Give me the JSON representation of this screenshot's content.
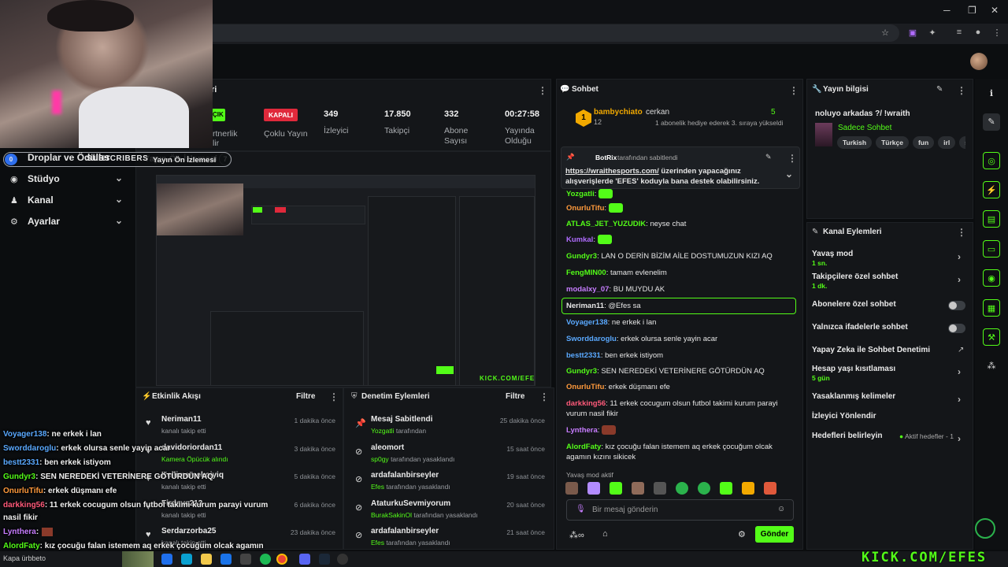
{
  "stats": {
    "status_badge": "ÇIK",
    "partner": "rtnerlik\nlir",
    "multistream_badge": "KAPALI",
    "multistream_label": "Çoklu Yayın",
    "viewers_value": "349",
    "viewers_label": "İzleyici",
    "followers_value": "17.850",
    "followers_label": "Takipçi",
    "subs_value": "332",
    "subs_label": "Abone Sayısı",
    "uptime_value": "00:27:58",
    "uptime_label": "Yayında Olduğu",
    "header_fragment": "ri"
  },
  "sidebar": {
    "drops_label": "Droplar ve Ödüller",
    "subscribers_overlay": "SUBSCRIBERS",
    "sub_count": "7",
    "sub_left": "0",
    "preview_label": "Yayın Ön İzlemesi",
    "items": [
      {
        "label": "Stüdyo"
      },
      {
        "label": "Kanal"
      },
      {
        "label": "Ayarlar"
      }
    ]
  },
  "activity": {
    "title": "Etkinlik Akışı",
    "filter": "Filtre",
    "rows": [
      {
        "name": "Neriman11",
        "desc": "kanalı takip etti",
        "time": "1 dakika önce"
      },
      {
        "name": "davidoriordan11",
        "desc": "Kamera Öpücük alındı",
        "time": "3 dakika önce"
      },
      {
        "name": "Kellimemekoiyiq",
        "desc": "kanalı takip etti",
        "time": "5 dakika önce"
      },
      {
        "name": "Firdevs213",
        "desc": "kanalı takip etti",
        "time": "6 dakika önce"
      },
      {
        "name": "Serdarzorba25",
        "desc": "kanalı takip etti",
        "time": "23 dakika önce"
      }
    ]
  },
  "moderation": {
    "title": "Denetim Eylemleri",
    "filter": "Filtre",
    "rows": [
      {
        "title": "Mesaj Sabitlendi",
        "by": "Yozgatli",
        "suffix": "tarafından",
        "time": "25 dakika önce"
      },
      {
        "title": "aleomort",
        "by": "sp0gy",
        "suffix": "tarafından yasaklandı",
        "time": "15 saat önce"
      },
      {
        "title": "ardafalanbirseyler",
        "by": "Efes",
        "suffix": "tarafından yasaklandı",
        "time": "19 saat önce"
      },
      {
        "title": "AtaturkuSevmiyorum",
        "by": "BurakSakinOl",
        "suffix": "tarafından yasaklandı",
        "time": "20 saat önce"
      },
      {
        "title": "ardafalanbirseyler",
        "by": "Efes",
        "suffix": "tarafından yasaklandı",
        "time": "21 saat önce"
      }
    ]
  },
  "chat": {
    "title": "Sohbet",
    "gifter": "bambychiato",
    "gifter_count": "12",
    "gift_to": "cerkan",
    "gift_badge": "5",
    "gift_text": "1 abonelik hediye ederek 3. sıraya yükseldi",
    "pinned_by": "BotRix",
    "pinned_suffix": "tarafından sabitlendi",
    "pinned_link": "https://wraithesports.com/",
    "pinned_text": " üzerinden yapacağınız alışverişlerde 'EFES' koduyla bana destek olabilirsiniz.",
    "slow_mode": "Yavaş mod aktif",
    "input_placeholder": "Bir mesaj gönderin",
    "send": "Gönder",
    "messages": [
      {
        "user": "Yozgatli",
        "text": "",
        "color": "#53fc18"
      },
      {
        "user": "OnurluTifu",
        "text": "",
        "color": "#ff9a3c"
      },
      {
        "user": "ATLAS_JET_YUZUDIK",
        "text": "neyse chat",
        "color": "#53fc18"
      },
      {
        "user": "Kumkal",
        "text": "",
        "color": "#b06cff"
      },
      {
        "user": "Gundyr3",
        "text": "LAN O DERİN BİZİM AİLE DOSTUMUZUN KIZI AQ",
        "color": "#53fc18"
      },
      {
        "user": "FengMIN00",
        "text": "tamam evlenelim",
        "color": "#53fc18"
      },
      {
        "user": "modalxy_07",
        "text": "BU MUYDU AK",
        "color": "#c77dff"
      },
      {
        "user": "Neriman11",
        "text": "@Efes sa",
        "color": "#e6e6e6"
      },
      {
        "user": "Voyager138",
        "text": "ne erkek i lan",
        "color": "#5aa9ff"
      },
      {
        "user": "Sworddaroglu",
        "text": "erkek olursa senle yayin acar",
        "color": "#5aa9ff"
      },
      {
        "user": "bestt2331",
        "text": "ben erkek istiyom",
        "color": "#5aa9ff"
      },
      {
        "user": "Gundyr3",
        "text": "SEN NEREDEKİ VETERİNERE GÖTÜRDÜN AQ",
        "color": "#53fc18"
      },
      {
        "user": "OnurluTifu",
        "text": "erkek düşmanı efe",
        "color": "#ff9a3c"
      },
      {
        "user": "darkking56",
        "text": "11 erkek cocugum olsun futbol takimi kurum parayi vurum nasil fikir",
        "color": "#ff5a7a"
      },
      {
        "user": "Lynthera",
        "text": "",
        "color": "#c77dff"
      },
      {
        "user": "AlordFaty",
        "text": "kız çocuğu falan istemem aq erkek çocuğum olcak agamın kızını sikicek",
        "color": "#53fc18"
      }
    ]
  },
  "info": {
    "title": "Yayın bilgisi",
    "stream_title": "noluyo arkadas ?/ !wraith",
    "category": "Sadece Sohbet",
    "tags": [
      "Turkish",
      "Türkçe",
      "fun",
      "irl",
      "spee"
    ]
  },
  "actions": {
    "title": "Kanal Eylemleri",
    "rows": [
      {
        "label": "Yavaş mod",
        "sub": "1 sn.",
        "kind": "chev"
      },
      {
        "label": "Takipçilere özel sohbet",
        "sub": "1 dk.",
        "kind": "chev"
      },
      {
        "label": "Abonelere özel sohbet",
        "sub": "",
        "kind": "toggle"
      },
      {
        "label": "Yalnızca ifadelerle sohbet",
        "sub": "",
        "kind": "toggle"
      },
      {
        "label": "Yapay Zeka ile Sohbet Denetimi",
        "sub": "",
        "kind": "ext"
      },
      {
        "label": "Hesap yaşı kısıtlaması",
        "sub": "5 gün",
        "kind": "chev"
      },
      {
        "label": "Yasaklanmış kelimeler",
        "sub": "",
        "kind": "chev"
      },
      {
        "label": "İzleyici Yönlendir",
        "sub": "",
        "kind": "none"
      },
      {
        "label": "Hedefleri belirleyin",
        "sub": "",
        "kind": "goal"
      }
    ],
    "goal_text": "Aktif hedefler - 1"
  },
  "overlay_chat": [
    {
      "user": "Voyager138",
      "text": ": ne erkek i lan",
      "color": "#5aa9ff"
    },
    {
      "user": "Sworddaroglu",
      "text": ": erkek olursa senle yayin acar",
      "color": "#5aa9ff"
    },
    {
      "user": "bestt2331",
      "text": ": ben erkek istiyom",
      "color": "#5aa9ff"
    },
    {
      "user": "Gundyr3",
      "text": ": SEN NEREDEKİ VETERİNERE GÖTÜRDÜN AQ",
      "color": "#53fc18"
    },
    {
      "user": "OnurluTifu",
      "text": ": erkek düşmanı efe",
      "color": "#ff9a3c"
    },
    {
      "user": "darkking56",
      "text": ": 11 erkek cocugum olsun futbol takimi kurum parayi vurum",
      "color": "#ff5a7a"
    },
    {
      "user": "",
      "text": "nasil fikir",
      "color": "#f0f0f0"
    },
    {
      "user": "Lynthera",
      "text": ":",
      "color": "#c77dff"
    },
    {
      "user": "AlordFaty",
      "text": ": kız çocuğu falan istemem aq erkek çocuğum olcak agamın",
      "color": "#53fc18"
    },
    {
      "user": "",
      "text": "kızını sikicek",
      "color": "#f0f0f0"
    }
  ],
  "watermark": "KICK.COM/EFES",
  "taskbar_search": "Kapa ürbbeto"
}
